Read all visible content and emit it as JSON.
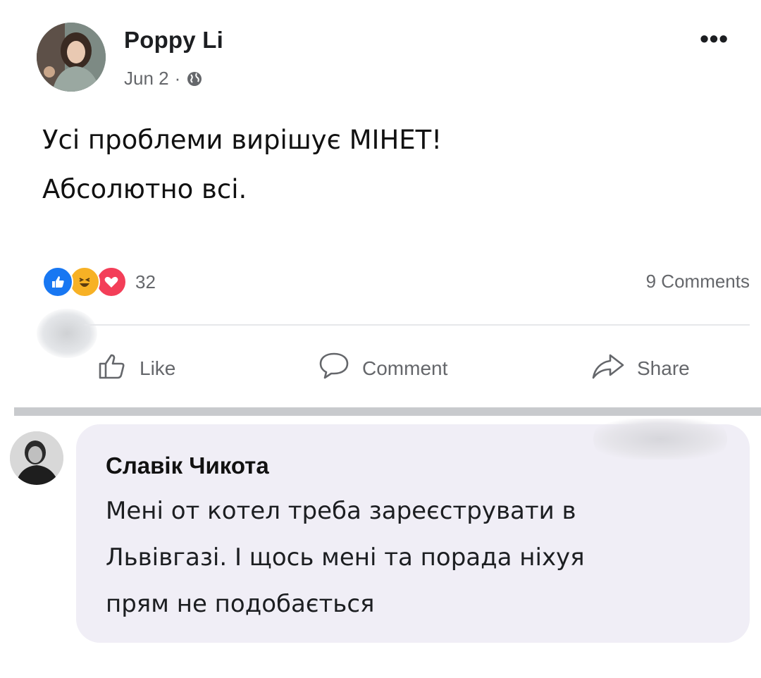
{
  "post": {
    "author": "Poppy Li",
    "date": "Jun 2",
    "separator": "·",
    "privacy_icon": "globe-icon",
    "more_label": "•••",
    "text_lines": [
      "Усі проблеми вирішує МІНЕТ!",
      "Абсолютно всі."
    ]
  },
  "reactions": {
    "icons": [
      "like-icon",
      "haha-icon",
      "love-icon"
    ],
    "count": "32",
    "comments_label": "9 Comments"
  },
  "actions": {
    "like_label": "Like",
    "comment_label": "Comment",
    "share_label": "Share"
  },
  "comment": {
    "author": "Славік Чикота",
    "text_lines": [
      "Мені от котел треба зареєструвати в",
      "Львівгазі. І щось мені та порада ніхуя",
      "прям не подобається"
    ]
  },
  "colors": {
    "facebook_blue": "#1877f2",
    "haha_yellow": "#f7b125",
    "love_red": "#f33e58",
    "meta_gray": "#65676b",
    "comment_bubble": "#f0eef6"
  }
}
